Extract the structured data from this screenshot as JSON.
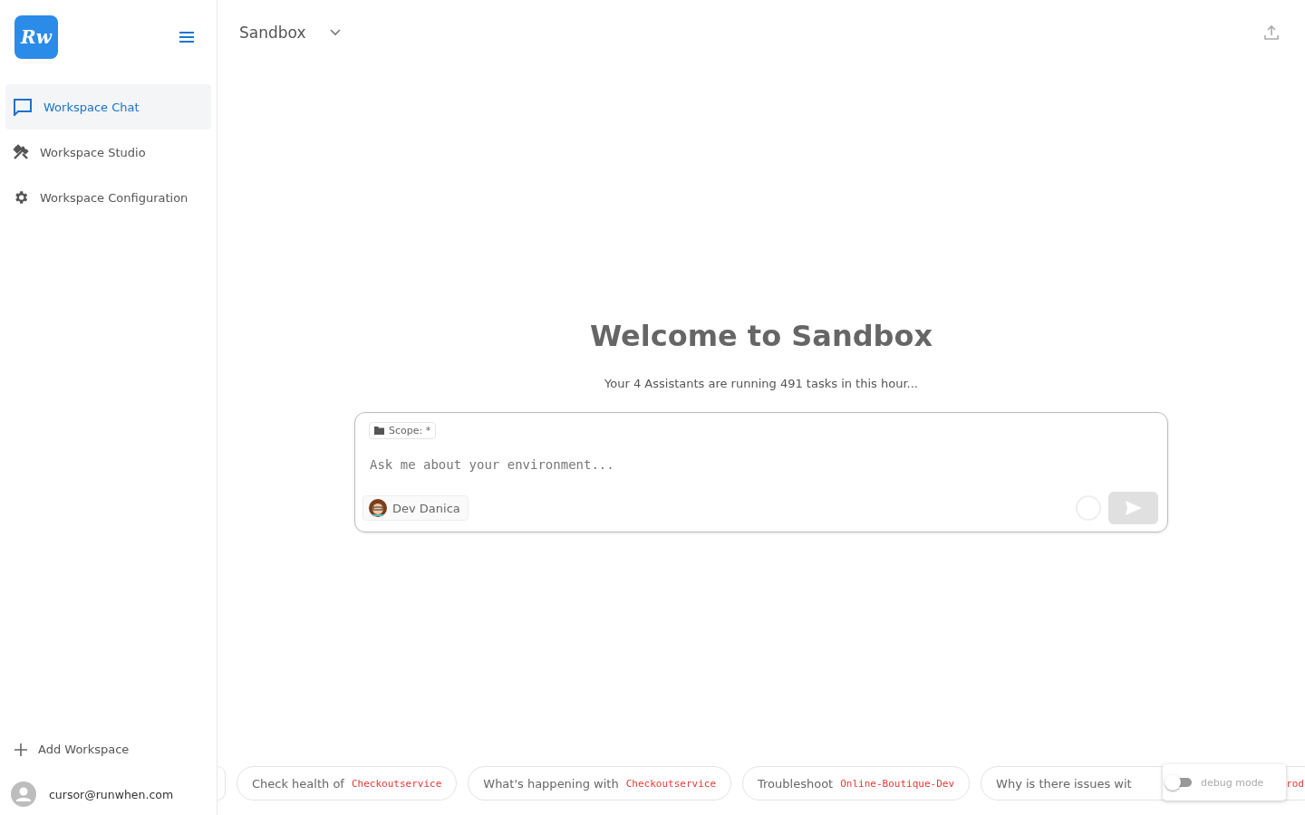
{
  "sidebar": {
    "logo_text": "Rw",
    "items": [
      {
        "label": "Workspace Chat",
        "selected": true
      },
      {
        "label": "Workspace Studio",
        "selected": false
      },
      {
        "label": "Workspace Configuration",
        "selected": false
      }
    ],
    "add_workspace": "Add Workspace",
    "user": "cursor@runwhen.com"
  },
  "header": {
    "workspace": "Sandbox"
  },
  "welcome": {
    "title": "Welcome to Sandbox",
    "subtitle": "Your 4 Assistants are running 491 tasks in this hour..."
  },
  "chat_box": {
    "scope": "Scope: *",
    "placeholder": "Ask me about your environment...",
    "assistant": "Dev Danica",
    "send_disabled": true
  },
  "suggestions": [
    {
      "text": "Check health of",
      "term": "Checkoutservice"
    },
    {
      "text": "What's happening with",
      "term": "Checkoutservice"
    },
    {
      "text": "Troubleshoot",
      "term": "Online-Boutique-Dev"
    },
    {
      "text": "Why is there issues wit",
      "term": "rod"
    }
  ],
  "debug": {
    "label": "debug mode",
    "on": false
  }
}
